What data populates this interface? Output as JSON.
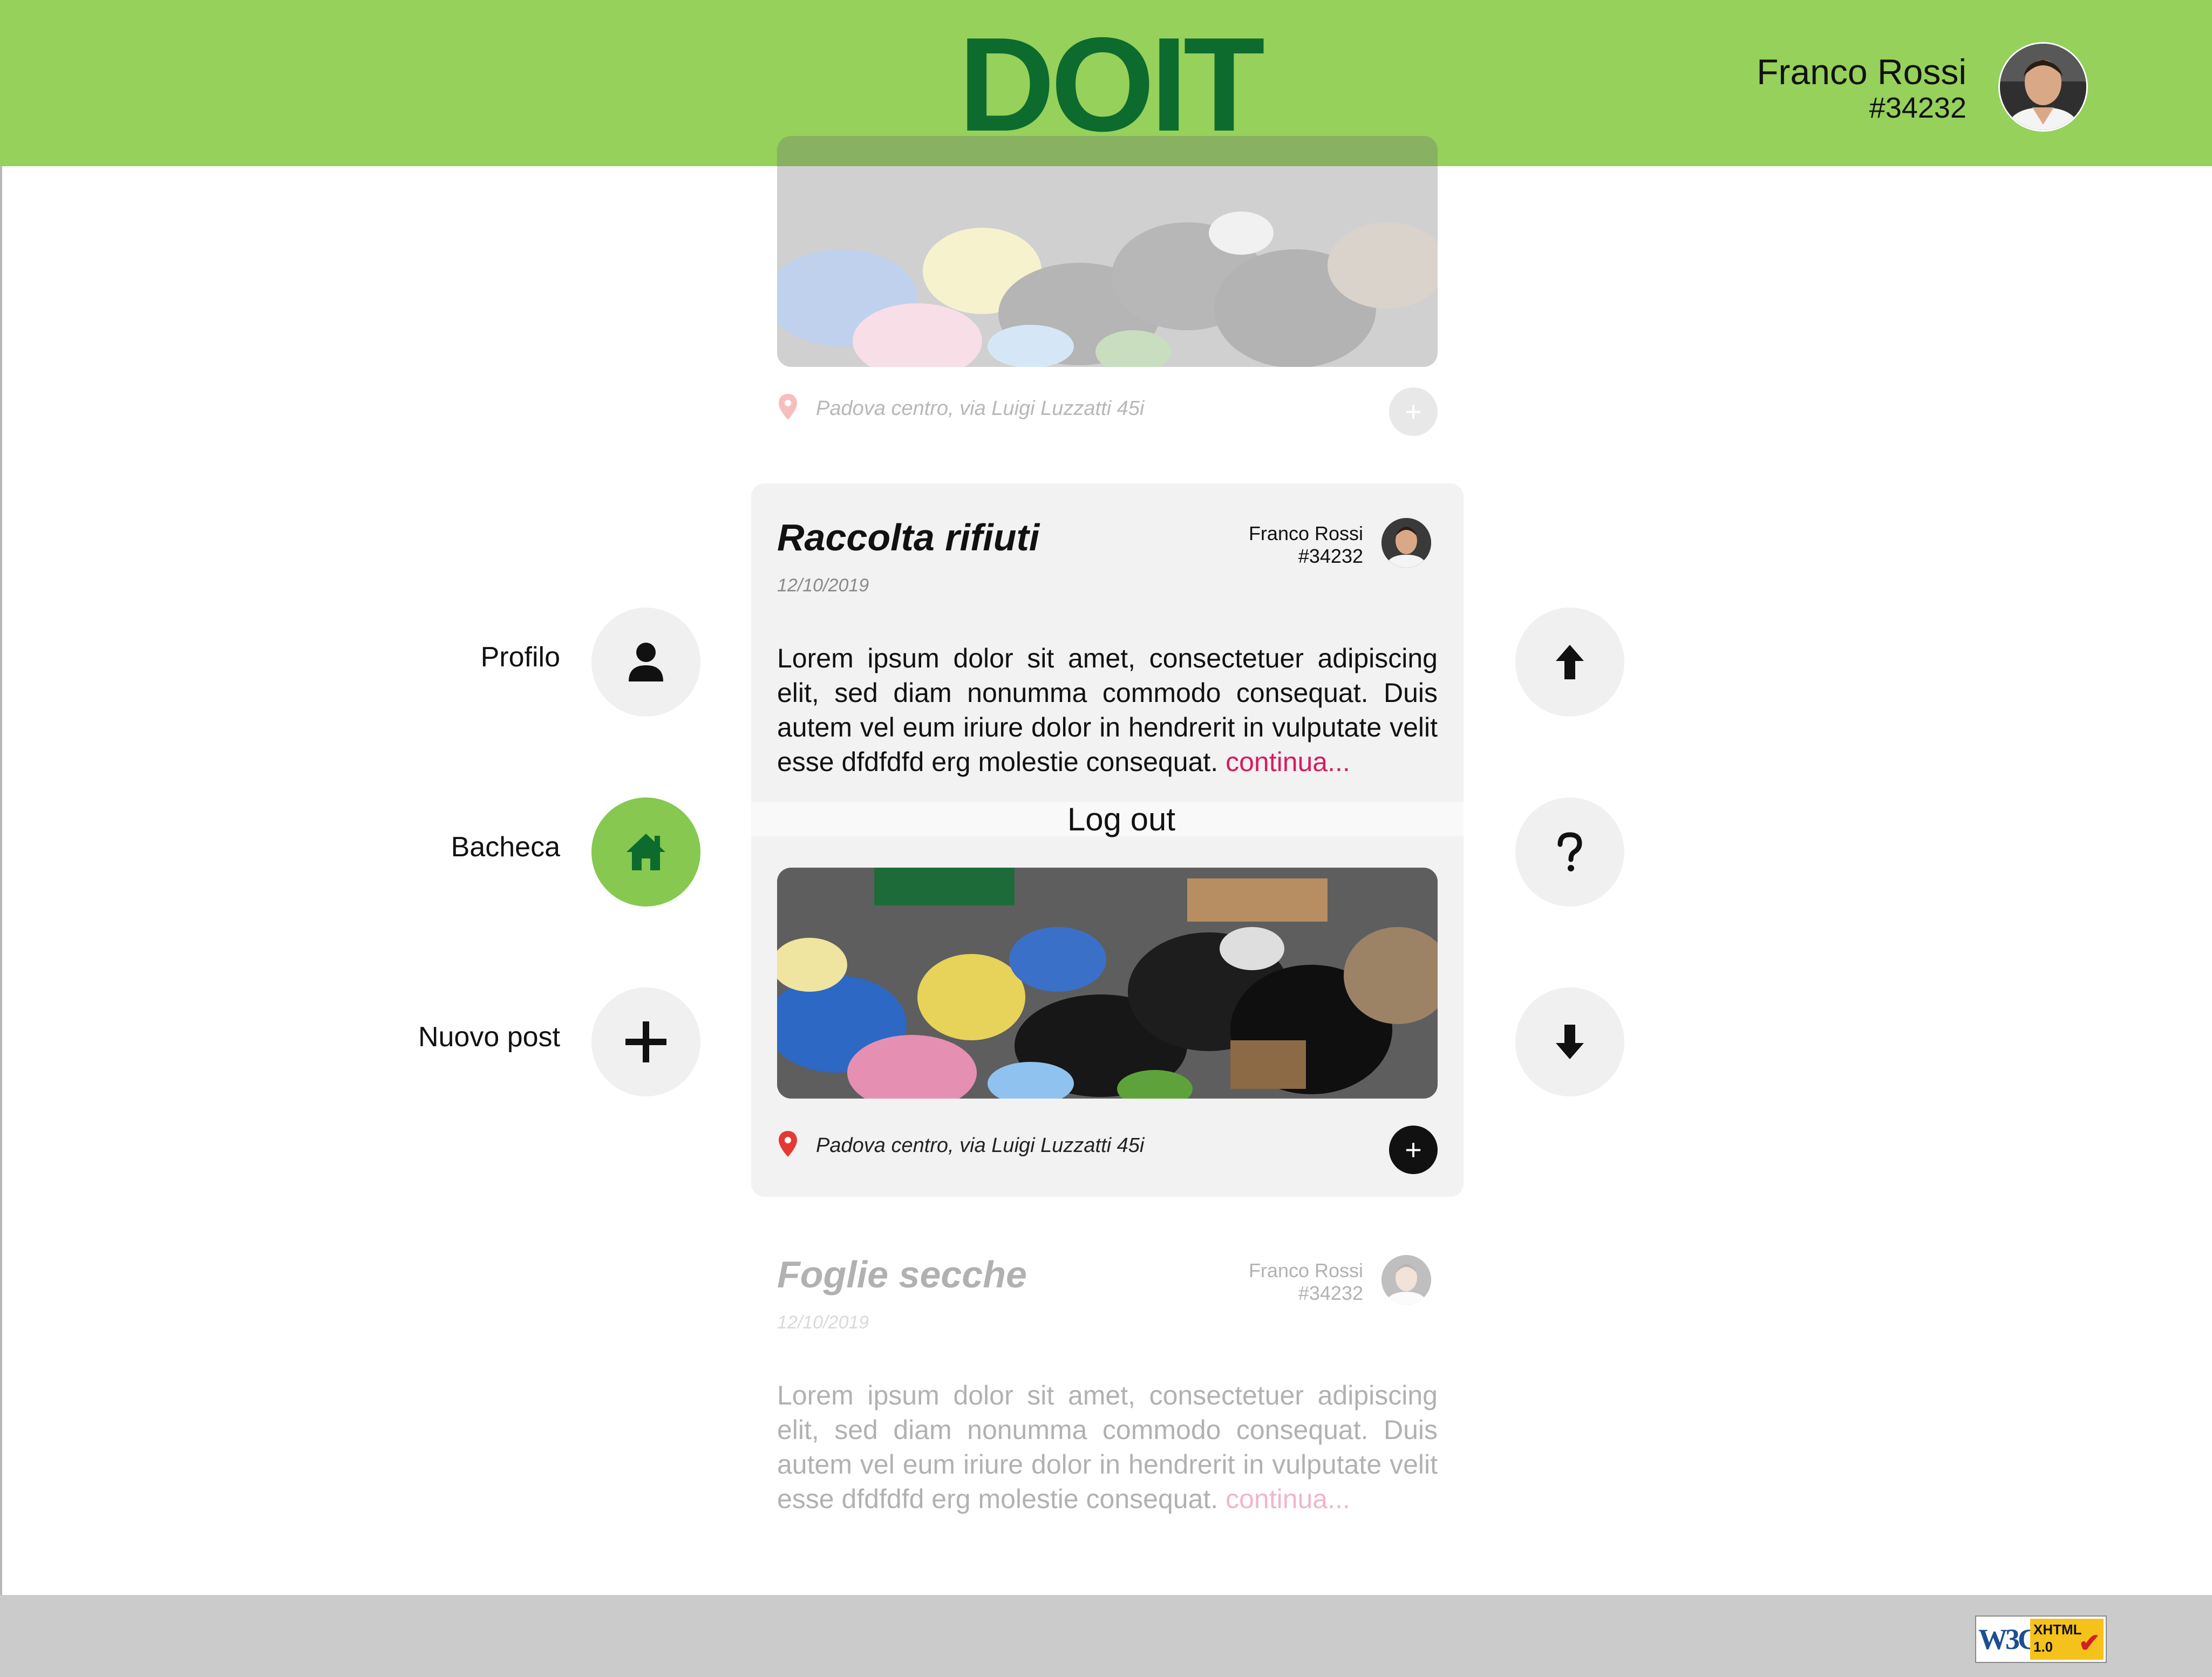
{
  "header": {
    "logo": "DOIT",
    "user": {
      "name": "Franco Rossi",
      "id": "#34232"
    }
  },
  "nav": {
    "items": [
      {
        "label": "Profilo",
        "icon": "user-icon",
        "active": false
      },
      {
        "label": "Bacheca",
        "icon": "home-icon",
        "active": true
      },
      {
        "label": "Nuovo post",
        "icon": "plus-icon",
        "active": false
      }
    ],
    "right": [
      {
        "icon": "arrow-up-icon"
      },
      {
        "icon": "help-icon"
      },
      {
        "icon": "arrow-down-icon"
      }
    ]
  },
  "posts": {
    "previous": {
      "location": "Padova centro, via Luigi Luzzatti 45i",
      "add": "+"
    },
    "current": {
      "title": "Raccolta rifiuti",
      "date": "12/10/2019",
      "author": "Franco Rossi",
      "author_id": "#34232",
      "body": "Lorem ipsum dolor sit amet, consectetuer adipiscing elit, sed diam nonumma commodo consequat. Duis autem vel eum iriure dolor in hendrerit in vulputate velit esse dfdfdfd erg molestie consequat.",
      "more": "continua...",
      "location": "Padova centro, via Luigi Luzzatti 45i",
      "add": "+"
    },
    "next": {
      "title": "Foglie secche",
      "date": "12/10/2019",
      "author": "Franco Rossi",
      "author_id": "#34232",
      "body": "Lorem ipsum dolor sit amet, consectetuer adipiscing elit, sed diam nonumma commodo consequat. Duis autem vel eum iriure dolor in hendrerit in vulputate velit esse dfdfdfd erg molestie consequat.",
      "more": "continua..."
    }
  },
  "menu": {
    "logout": "Log out"
  },
  "footer": {
    "badge_left": "W3C",
    "badge_line1": "XHTML",
    "badge_line2": "1.0"
  },
  "colors": {
    "header": "#95d15b",
    "logo": "#0d6b2e",
    "active_nav": "#86c850",
    "link": "#d81b60",
    "pin": "#e53935",
    "footer": "#cbcbcb"
  }
}
